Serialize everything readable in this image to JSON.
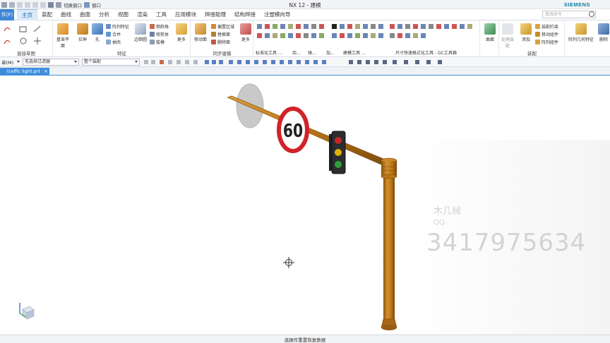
{
  "titlebar": {
    "switch_window": "切换窗口",
    "window": "窗口",
    "title": "NX 12 - 建模",
    "brand": "SIEMENS"
  },
  "menubar": {
    "file": "件(F)",
    "tabs": [
      "主页",
      "装配",
      "曲线",
      "曲面",
      "分析",
      "视图",
      "渲染",
      "工具",
      "应用模块",
      "焊接助理",
      "结构焊接",
      "注塑模向导"
    ],
    "active_tab": "主页",
    "search_placeholder": "查找命令"
  },
  "ribbon": {
    "direct_sketch": "直接草图",
    "feature": {
      "label": "特征",
      "datum_plane": "基准平面",
      "extrude": "拉伸",
      "hole": "孔",
      "pattern_feature": "阵列特征",
      "unite": "合并",
      "shell": "抽壳",
      "edge_blend": "边倒圆",
      "chamfer": "倒斜角",
      "trim_body": "修剪体",
      "draft": "拔模",
      "more": "更多"
    },
    "sync": {
      "label": "同步建模",
      "move_face": "移动面",
      "offset_region": "偏置区域",
      "replace_face": "替换面",
      "delete_face": "删除面",
      "more": "更多"
    },
    "std_parts": "标准化工具 ...",
    "gear": "齿...",
    "spring": "弹...",
    "machining": "加...",
    "build_tools": "建模工具 ...",
    "gc_toolbox": "尺寸快速格式化工具 - GC工具箱",
    "surface": "曲面",
    "assembly": {
      "label": "装配",
      "constraint": "装配约束",
      "move_component": "移动组件",
      "pattern_component": "阵列组件",
      "add": "添加",
      "existing": "处理装配"
    },
    "pattern_geometry": "阵列几何特征",
    "delete": "删除"
  },
  "toolbar2": {
    "menu": "单(M)",
    "filter": "无选择过滤器",
    "scope": "整个装配"
  },
  "document": {
    "tab_label": "traffic light.prt"
  },
  "viewport": {
    "speed_sign": "60",
    "watermark_name": "木几械",
    "watermark_qq": "QQ:",
    "watermark_number": "3417975634"
  },
  "status": {
    "text": "选操作重置恢复数据"
  },
  "colors": {
    "accent": "#3d8fdc",
    "pole": "#c07a1e",
    "pole_dark": "#8a5410",
    "sign_red": "#d1232a",
    "light_red": "#c62828",
    "light_yellow": "#e0b000",
    "light_green": "#2e9e3a"
  }
}
